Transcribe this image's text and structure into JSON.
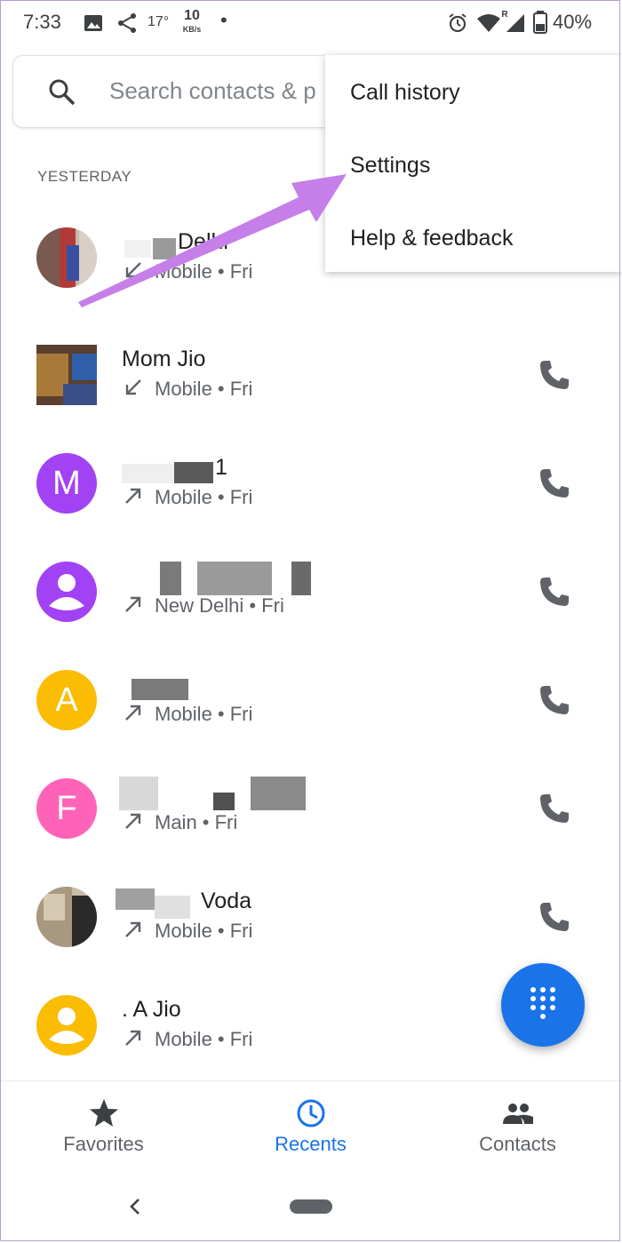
{
  "status": {
    "time": "7:33",
    "temp": "17°",
    "speed_value": "10",
    "speed_unit": "KB/s",
    "dot": "•",
    "roaming": "R",
    "battery": "40%"
  },
  "search": {
    "placeholder": "Search contacts & p"
  },
  "section_label": "YESTERDAY",
  "menu": {
    "items": [
      "Call history",
      "Settings",
      "Help & feedback"
    ]
  },
  "calls": [
    {
      "name": "Delhi",
      "detail": "Mobile • Fri",
      "direction": "incoming",
      "avatar_icon": "photo"
    },
    {
      "name": "Mom Jio",
      "detail": "Mobile • Fri",
      "direction": "incoming",
      "avatar_icon": "photo"
    },
    {
      "name": "1",
      "detail": "Mobile • Fri",
      "direction": "outgoing",
      "avatar_letter": "M",
      "color": "#a142f4"
    },
    {
      "name": "",
      "detail": "New Delhi • Fri",
      "direction": "outgoing",
      "avatar_icon": "person-icon",
      "color": "#a142f4"
    },
    {
      "name": "",
      "detail": "Mobile • Fri",
      "direction": "outgoing",
      "avatar_letter": "A",
      "color": "#fbbc04"
    },
    {
      "name": "",
      "detail": "Main • Fri",
      "direction": "outgoing",
      "avatar_letter": "F",
      "color": "#ff63b8"
    },
    {
      "name": "Voda",
      "detail": "Mobile • Fri",
      "direction": "outgoing",
      "avatar_icon": "photo"
    },
    {
      "name": ". A Jio",
      "detail": "Mobile • Fri",
      "direction": "outgoing",
      "avatar_icon": "person-icon",
      "color": "#fbbc04"
    }
  ],
  "nav": {
    "items": [
      {
        "label": "Favorites",
        "icon": "star-icon",
        "active": false
      },
      {
        "label": "Recents",
        "icon": "clock-icon",
        "active": true
      },
      {
        "label": "Contacts",
        "icon": "people-icon",
        "active": false
      }
    ]
  },
  "colors": {
    "accent": "#1a73e8",
    "annotation_arrow": "#c67ee8"
  }
}
